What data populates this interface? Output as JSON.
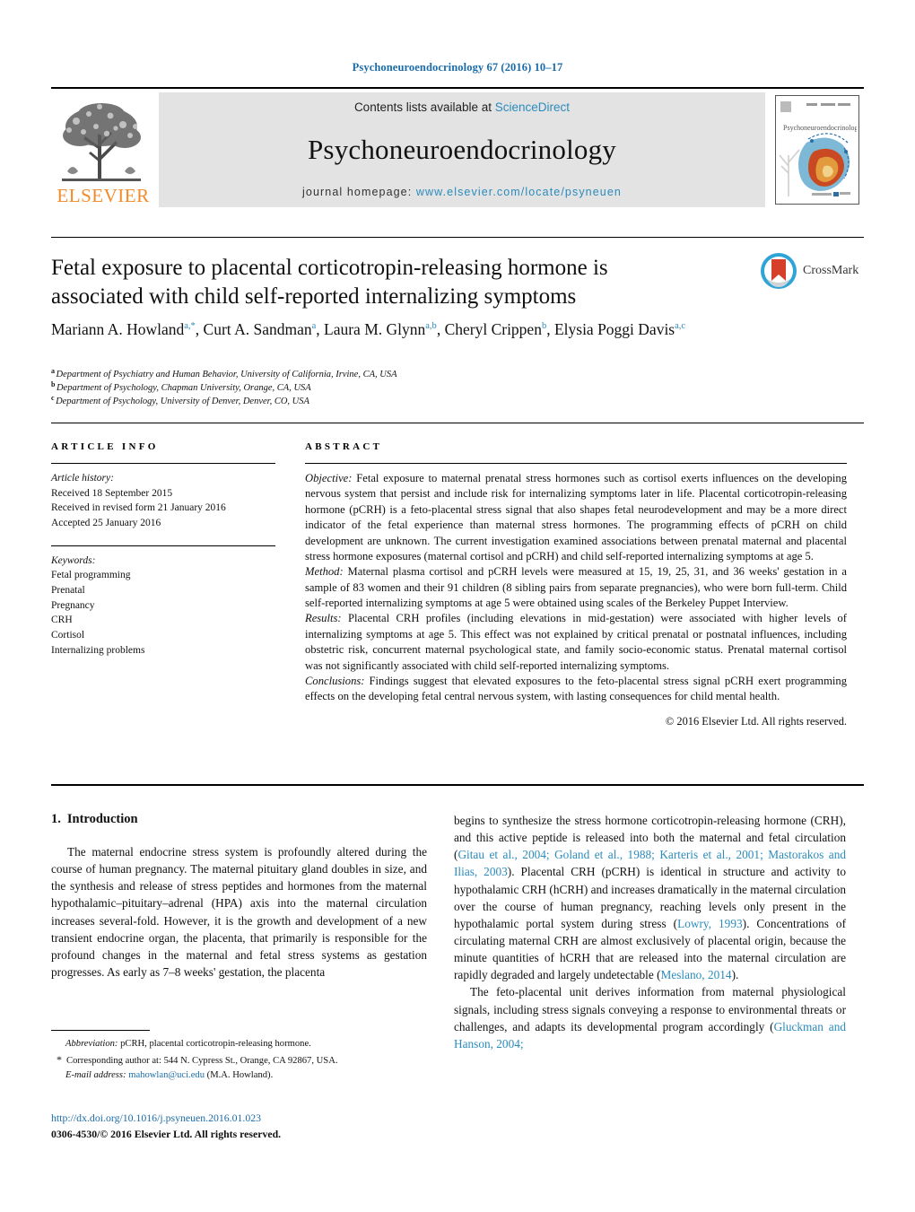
{
  "running_head": "Psychoneuroendocrinology 67 (2016) 10–17",
  "masthead": {
    "publisher": "ELSEVIER",
    "contents_prefix": "Contents lists available at ",
    "contents_link": "ScienceDirect",
    "journal_title": "Psychoneuroendocrinology",
    "homepage_prefix": "journal homepage: ",
    "homepage_url": "www.elsevier.com/locate/psyneuen",
    "cover_title": "Psychoneuroendocrinology"
  },
  "crossmark": {
    "label": "CrossMark"
  },
  "article": {
    "title": "Fetal exposure to placental corticotropin-releasing hormone is associated with child self-reported internalizing symptoms",
    "authors": [
      {
        "name": "Mariann A. Howland",
        "sup": "a,*"
      },
      {
        "name": "Curt A. Sandman",
        "sup": "a"
      },
      {
        "name": "Laura M. Glynn",
        "sup": "a,b"
      },
      {
        "name": "Cheryl Crippen",
        "sup": "b"
      },
      {
        "name": "Elysia Poggi Davis",
        "sup": "a,c"
      }
    ],
    "affiliations": [
      {
        "mark": "a",
        "text": "Department of Psychiatry and Human Behavior, University of California, Irvine, CA, USA"
      },
      {
        "mark": "b",
        "text": "Department of Psychology, Chapman University, Orange, CA, USA"
      },
      {
        "mark": "c",
        "text": "Department of Psychology, University of Denver, Denver, CO, USA"
      }
    ]
  },
  "article_info": {
    "heading": "ARTICLE INFO",
    "history_label": "Article history:",
    "history": [
      "Received 18 September 2015",
      "Received in revised form 21 January 2016",
      "Accepted 25 January 2016"
    ],
    "keywords_label": "Keywords:",
    "keywords": [
      "Fetal programming",
      "Prenatal",
      "Pregnancy",
      "CRH",
      "Cortisol",
      "Internalizing problems"
    ]
  },
  "abstract": {
    "heading": "ABSTRACT",
    "sections": [
      {
        "label": "Objective:",
        "text": " Fetal exposure to maternal prenatal stress hormones such as cortisol exerts influences on the developing nervous system that persist and include risk for internalizing symptoms later in life. Placental corticotropin-releasing hormone (pCRH) is a feto-placental stress signal that also shapes fetal neurodevelopment and may be a more direct indicator of the fetal experience than maternal stress hormones. The programming effects of pCRH on child development are unknown. The current investigation examined associations between prenatal maternal and placental stress hormone exposures (maternal cortisol and pCRH) and child self-reported internalizing symptoms at age 5."
      },
      {
        "label": "Method:",
        "text": " Maternal plasma cortisol and pCRH levels were measured at 15, 19, 25, 31, and 36 weeks' gestation in a sample of 83 women and their 91 children (8 sibling pairs from separate pregnancies), who were born full-term. Child self-reported internalizing symptoms at age 5 were obtained using scales of the Berkeley Puppet Interview."
      },
      {
        "label": "Results:",
        "text": " Placental CRH profiles (including elevations in mid-gestation) were associated with higher levels of internalizing symptoms at age 5. This effect was not explained by critical prenatal or postnatal influences, including obstetric risk, concurrent maternal psychological state, and family socio-economic status. Prenatal maternal cortisol was not significantly associated with child self-reported internalizing symptoms."
      },
      {
        "label": "Conclusions:",
        "text": " Findings suggest that elevated exposures to the feto-placental stress signal pCRH exert programming effects on the developing fetal central nervous system, with lasting consequences for child mental health."
      }
    ],
    "copyright": "© 2016 Elsevier Ltd. All rights reserved."
  },
  "introduction": {
    "number": "1.",
    "heading": "Introduction",
    "left_paragraphs": [
      "The maternal endocrine stress system is profoundly altered during the course of human pregnancy. The maternal pituitary gland doubles in size, and the synthesis and release of stress peptides and hormones from the maternal hypothalamic–pituitary–adrenal (HPA) axis into the maternal circulation increases several-fold. However, it is the growth and development of a new transient endocrine organ, the placenta, that primarily is responsible for the profound changes in the maternal and fetal stress systems as gestation progresses. As early as 7–8 weeks' gestation, the placenta"
    ],
    "right_paragraph_1_parts": [
      {
        "type": "text",
        "value": "begins to synthesize the stress hormone corticotropin-releasing hormone (CRH), and this active peptide is released into both the maternal and fetal circulation ("
      },
      {
        "type": "ref",
        "value": "Gitau et al., 2004; Goland et al., 1988; Karteris et al., 2001; Mastorakos and Ilias, 2003"
      },
      {
        "type": "text",
        "value": "). Placental CRH (pCRH) is identical in structure and activity to hypothalamic CRH (hCRH) and increases dramatically in the maternal circulation over the course of human pregnancy, reaching levels only present in the hypothalamic portal system during stress ("
      },
      {
        "type": "ref",
        "value": "Lowry, 1993"
      },
      {
        "type": "text",
        "value": "). Concentrations of circulating maternal CRH are almost exclusively of placental origin, because the minute quantities of hCRH that are released into the maternal circulation are rapidly degraded and largely undetectable ("
      },
      {
        "type": "ref",
        "value": "Meslano, 2014"
      },
      {
        "type": "text",
        "value": ")."
      }
    ],
    "right_paragraph_2_parts": [
      {
        "type": "text",
        "value": "The feto-placental unit derives information from maternal physiological signals, including stress signals conveying a response to environmental threats or challenges, and adapts its developmental program accordingly ("
      },
      {
        "type": "ref",
        "value": "Gluckman and Hanson, 2004;"
      }
    ]
  },
  "footnotes": {
    "abbreviation_label": "Abbreviation:",
    "abbreviation_text": " pCRH, placental corticotropin-releasing hormone.",
    "corresponding_mark": "*",
    "corresponding_text": "Corresponding author at: 544 N. Cypress St., Orange, CA 92867, USA.",
    "email_label": "E-mail address:",
    "email": "mahowlan@uci.edu",
    "email_suffix": " (M.A. Howland)."
  },
  "publication_footer": {
    "doi": "http://dx.doi.org/10.1016/j.psyneuen.2016.01.023",
    "issn_line": "0306-4530/© 2016 Elsevier Ltd. All rights reserved."
  },
  "colors": {
    "link": "#1b6ca8",
    "science_direct": "#2b8bbd",
    "elsevier_orange": "#F28B28",
    "reference": "#2b8bbd"
  }
}
